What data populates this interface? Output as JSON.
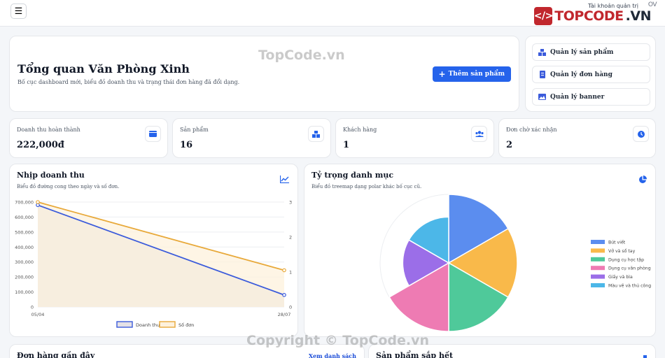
{
  "topbar": {
    "menu_icon": "hamburger-icon",
    "account_label": "Tài khoản quản trị",
    "logo": {
      "part1": "TOPCODE",
      "part2": ".VN",
      "badge": "OV"
    }
  },
  "hero": {
    "title": "Tổng quan Văn Phòng Xinh",
    "subtitle": "Bố cục dashboard mới, biểu đồ doanh thu và trạng thái đơn hàng đã đổi dạng.",
    "add_button": "Thêm sản phẩm"
  },
  "quick_links": [
    {
      "label": "Quản lý sản phẩm",
      "icon": "boxes-icon"
    },
    {
      "label": "Quản lý đơn hàng",
      "icon": "receipt-icon"
    },
    {
      "label": "Quản lý banner",
      "icon": "image-icon"
    }
  ],
  "stats": [
    {
      "label": "Doanh thu hoàn thành",
      "value": "222,000đ",
      "icon": "wallet-icon"
    },
    {
      "label": "Sản phẩm",
      "value": "16",
      "icon": "boxes-icon"
    },
    {
      "label": "Khách hàng",
      "value": "1",
      "icon": "users-icon"
    },
    {
      "label": "Đơn chờ xác nhận",
      "value": "2",
      "icon": "clock-icon"
    }
  ],
  "revenue_panel": {
    "title": "Nhịp doanh thu",
    "subtitle": "Biểu đồ đường cong theo ngày và số đơn.",
    "icon": "line-chart-icon"
  },
  "category_panel": {
    "title": "Tỷ trọng danh mục",
    "subtitle": "Biểu đồ treemap dạng polar khác bố cục cũ.",
    "icon": "pie-chart-icon"
  },
  "recent_orders": {
    "title": "Đơn hàng gần đây",
    "view_all": "Xem danh sách"
  },
  "low_stock": {
    "title": "Sản phẩm sắp hết",
    "icon": "boxes-icon"
  },
  "watermarks": {
    "top": "TopCode.vn",
    "bottom": "Copyright © TopCode.vn"
  },
  "colors": {
    "accent": "#2563eb",
    "revenue_line": "#3b5bdb",
    "orders_line": "#e8a93a",
    "logo_red": "#c1272d"
  },
  "chart_data": [
    {
      "type": "line",
      "x": [
        "05/04",
        "28/07"
      ],
      "series": [
        {
          "name": "Doanh thu",
          "axis": "left",
          "values": [
            680000,
            80000
          ],
          "color": "#3b5bdb",
          "fill": "#e4e1e6"
        },
        {
          "name": "Số đơn",
          "axis": "right",
          "values": [
            3,
            1.05
          ],
          "color": "#e8a93a",
          "fill": "#fdf1dc"
        }
      ],
      "y_left": {
        "min": 0,
        "max": 700000,
        "ticks": [
          0,
          100000,
          200000,
          300000,
          400000,
          500000,
          600000,
          700000
        ],
        "tick_labels": [
          "0",
          "100,000",
          "200,000",
          "300,000",
          "400,000",
          "500,000",
          "600,000",
          "700,000"
        ]
      },
      "y_right": {
        "min": 0,
        "max": 3,
        "ticks": [
          0,
          1,
          2,
          3
        ],
        "tick_labels": [
          "0",
          "1",
          "2",
          "3"
        ]
      },
      "grid": true,
      "legend": "bottom"
    },
    {
      "type": "pie",
      "variant": "polar-area",
      "labels": [
        "Bút viết",
        "Vở và sổ tay",
        "Dụng cụ học tập",
        "Dụng cụ văn phòng",
        "Giấy và bìa",
        "Màu vẽ và thủ công"
      ],
      "values": [
        1,
        1,
        1,
        1,
        1,
        1
      ],
      "radii": [
        1.0,
        1.0,
        1.0,
        1.0,
        0.67,
        0.67
      ],
      "colors": [
        "#5b8def",
        "#f9b94a",
        "#4fc99a",
        "#ee7bb3",
        "#9b6ee8",
        "#4cb7e8"
      ],
      "legend": "right"
    }
  ]
}
